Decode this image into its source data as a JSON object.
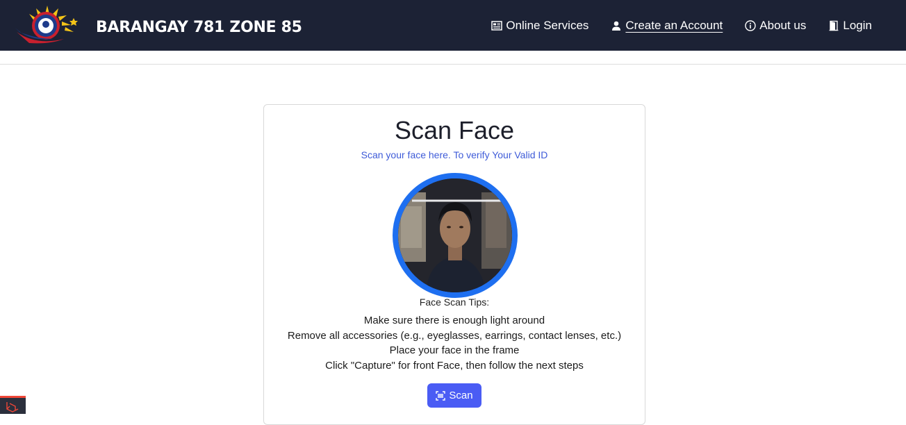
{
  "header": {
    "brand_name": "BARANGAY 781 ZONE 85",
    "nav": [
      {
        "label": "Online Services",
        "icon": "newspaper-icon"
      },
      {
        "label": "Create an Account",
        "icon": "person-icon"
      },
      {
        "label": "About us",
        "icon": "info-icon"
      },
      {
        "label": "Login",
        "icon": "door-icon"
      }
    ]
  },
  "card": {
    "title": "Scan Face",
    "subtitle": "Scan your face here. To verify Your Valid ID",
    "tips_heading": "Face Scan Tips:",
    "tips": [
      "Make sure there is enough light around",
      "Remove all accessories (e.g., eyeglasses, earrings, contact lenses, etc.)",
      "Place your face in the frame",
      "Click \"Capture\" for front Face, then follow the next steps"
    ],
    "scan_button": "Scan"
  },
  "colors": {
    "navbar": "#1c2235",
    "accent": "#4a5cf4",
    "ring": "#1e6ff0",
    "subtitle": "#3e5bd8"
  }
}
